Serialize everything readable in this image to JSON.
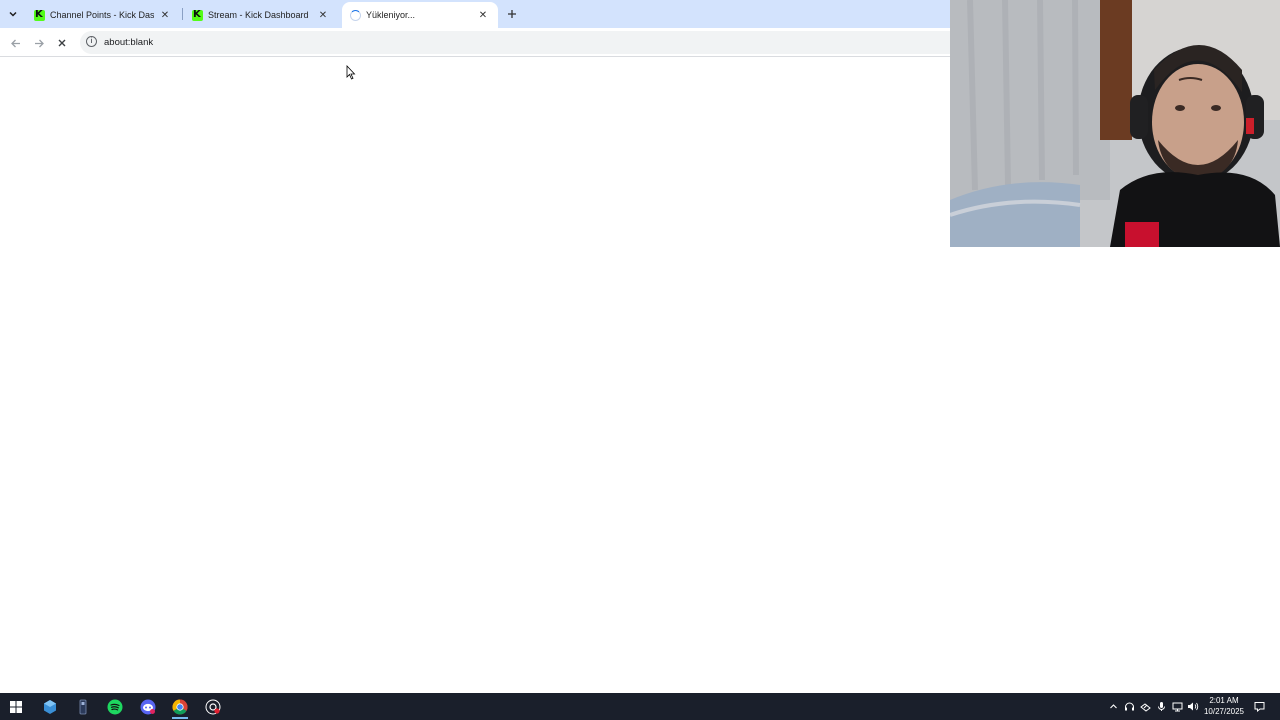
{
  "browser": {
    "tabs": [
      {
        "title": "Channel Points - Kick Dashboard",
        "favicon": "kick-logo",
        "active": false
      },
      {
        "title": "Stream - Kick Dashboard",
        "favicon": "kick-logo",
        "active": false
      },
      {
        "title": "Yükleniyor...",
        "favicon": "loading-spinner",
        "active": true
      }
    ],
    "address_bar": {
      "url": "about:blank"
    }
  },
  "taskbar": {
    "pinned_apps": [
      "windows-start",
      "kick-studio",
      "usb-device",
      "spotify",
      "discord",
      "chrome",
      "obs-streaming"
    ],
    "clock": {
      "time": "2:01 AM",
      "date": "10/27/2025"
    }
  },
  "colors": {
    "tabstrip": "#d3e3fd",
    "kick_green": "#53fc18",
    "taskbar": "#1a1f2b"
  }
}
